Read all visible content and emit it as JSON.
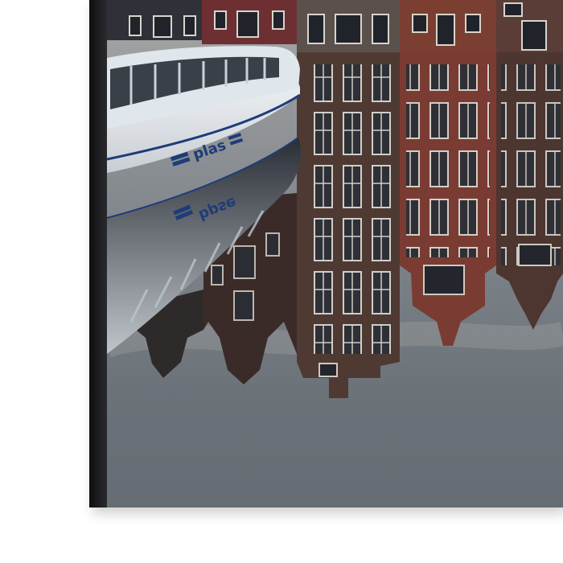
{
  "artwork": {
    "kind": "framed-canvas-print",
    "boat_name": "plas",
    "colors": {
      "frame": "#1b1b1d",
      "sky": "#8b8f95",
      "brick_red": "#7a3c32",
      "brick_dark": "#4d3530",
      "boat_white": "#e9ecef",
      "boat_stripe": "#1e3c78"
    }
  }
}
